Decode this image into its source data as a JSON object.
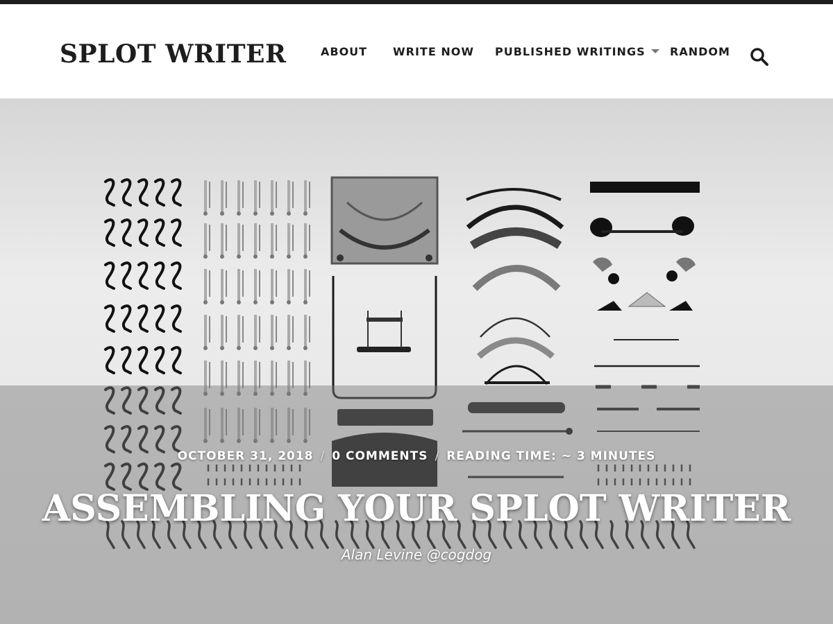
{
  "site": {
    "title": "SPLOT WRITER"
  },
  "nav": {
    "items": [
      {
        "label": "ABOUT"
      },
      {
        "label": "WRITE NOW"
      },
      {
        "label": "PUBLISHED WRITINGS",
        "has_dropdown": true
      },
      {
        "label": "RANDOM"
      }
    ],
    "search_icon": "search-icon",
    "dropdown_icon": "caret-down-icon"
  },
  "post": {
    "date": "OCTOBER 31, 2018",
    "comments": "0 COMMENTS",
    "reading_time": "READING TIME: ~ 3 MINUTES",
    "separator": "/",
    "title": "ASSEMBLING YOUR SPLOT WRITER",
    "author": "Alan Levine @cogdog"
  },
  "colors": {
    "text_dark": "#1d1d1d",
    "hero_background": "#e9e9e9",
    "hero_overlay": "#787878",
    "white": "#ffffff"
  }
}
